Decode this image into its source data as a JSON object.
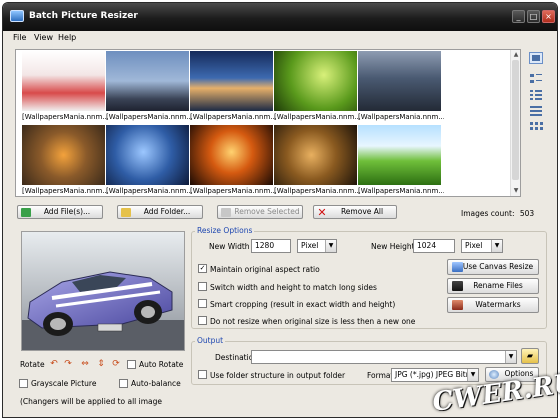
{
  "window": {
    "title": "Batch Picture Resizer"
  },
  "menu": [
    "File",
    "View",
    "Help"
  ],
  "gallery": {
    "captions": [
      "[WallpapersMania.nnm....",
      "[WallpapersMania.nnm....",
      "[WallpapersMania.nnm....",
      "[WallpapersMania.nnm....",
      "[WallpapersMania.nnm....",
      "[WallpapersMania.nnm....",
      "[WallpapersMania.nnm....",
      "[WallpapersMania.nnm....",
      "[WallpapersMania.nnm....",
      "[WallpapersMania.nnm...."
    ]
  },
  "toolbar": {
    "add_files": "Add File(s)...",
    "add_folder": "Add Folder...",
    "remove_selected": "Remove Selected",
    "remove_all": "Remove All",
    "images_count_label": "Images count:",
    "images_count_value": "503"
  },
  "left": {
    "rotate_label": "Rotate",
    "auto_rotate": "Auto Rotate",
    "grayscale": "Grayscale Picture",
    "auto_balance": "Auto-balance",
    "status": "(Changers will be applied to all image"
  },
  "resize": {
    "legend": "Resize Options",
    "new_width_label": "New Width",
    "new_width_value": "1280",
    "width_unit": "Pixel",
    "new_height_label": "New Height",
    "new_height_value": "1024",
    "height_unit": "Pixel",
    "opt_aspect": "Maintain original aspect ratio",
    "opt_switch": "Switch width and height to match long sides",
    "opt_smart": "Smart cropping (result in exact width and height)",
    "opt_noresize": "Do not resize when original size is less then a new one",
    "aspect_checked": "✓"
  },
  "side_buttons": {
    "canvas": "Use Canvas Resize",
    "rename": "Rename Files",
    "watermarks": "Watermarks"
  },
  "output": {
    "legend": "Output",
    "destination_label": "Destination",
    "destination_value": "",
    "structure": "Use folder structure in output folder",
    "format_label": "Format",
    "format_value": "JPG (*.jpg) JPEG Bitma",
    "options": "Options"
  },
  "watermark_text": "CWER.RU"
}
